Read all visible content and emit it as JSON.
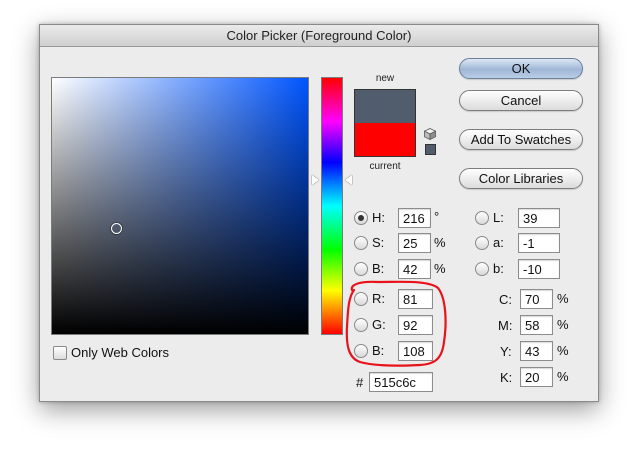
{
  "window": {
    "title": "Color Picker (Foreground Color)"
  },
  "swatches": {
    "new_label": "new",
    "current_label": "current",
    "new_color": "#515c6c",
    "current_color": "#ff0000"
  },
  "buttons": {
    "ok": "OK",
    "cancel": "Cancel",
    "add_to_swatches": "Add To Swatches",
    "color_libraries": "Color Libraries"
  },
  "hsb": {
    "h": {
      "label": "H:",
      "value": "216",
      "unit": "°"
    },
    "s": {
      "label": "S:",
      "value": "25",
      "unit": "%"
    },
    "b": {
      "label": "B:",
      "value": "42",
      "unit": "%"
    }
  },
  "rgb": {
    "r": {
      "label": "R:",
      "value": "81"
    },
    "g": {
      "label": "G:",
      "value": "92"
    },
    "b": {
      "label": "B:",
      "value": "108"
    }
  },
  "lab": {
    "l": {
      "label": "L:",
      "value": "39"
    },
    "a": {
      "label": "a:",
      "value": "-1"
    },
    "b": {
      "label": "b:",
      "value": "-10"
    }
  },
  "cmyk": {
    "c": {
      "label": "C:",
      "value": "70",
      "unit": "%"
    },
    "m": {
      "label": "M:",
      "value": "58",
      "unit": "%"
    },
    "y": {
      "label": "Y:",
      "value": "43",
      "unit": "%"
    },
    "k": {
      "label": "K:",
      "value": "20",
      "unit": "%"
    }
  },
  "hex": {
    "label": "#",
    "value": "515c6c"
  },
  "only_web_colors": {
    "label": "Only Web Colors",
    "checked": false
  },
  "colors": {
    "annotation": "#e8121a",
    "field_hue": "#0055ff"
  }
}
